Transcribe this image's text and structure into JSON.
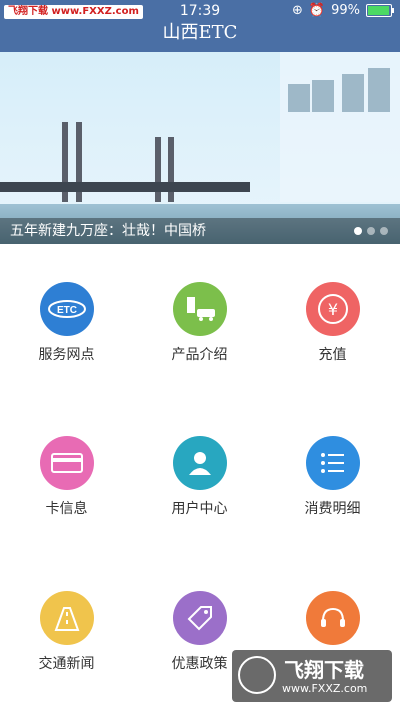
{
  "status_bar": {
    "watermark": "飞翔下载 www.FXXZ.com",
    "time": "17:39",
    "battery": "99%"
  },
  "header": {
    "title": "山西ETC"
  },
  "banner": {
    "caption": "五年新建九万座：壮哉！中国桥",
    "page_count": 3,
    "active_page": 1
  },
  "grid": [
    {
      "label": "服务网点",
      "icon": "etc-icon",
      "color": "#2e7fd4"
    },
    {
      "label": "产品介绍",
      "icon": "car-gas-icon",
      "color": "#7cbf4b"
    },
    {
      "label": "充值",
      "icon": "yuan-icon",
      "color": "#ef6464"
    },
    {
      "label": "卡信息",
      "icon": "card-icon",
      "color": "#e86bb4"
    },
    {
      "label": "用户中心",
      "icon": "user-icon",
      "color": "#28a7c0"
    },
    {
      "label": "消费明细",
      "icon": "list-icon",
      "color": "#2f8ee0"
    },
    {
      "label": "交通新闻",
      "icon": "road-icon",
      "color": "#f0c44c"
    },
    {
      "label": "优惠政策",
      "icon": "tag-icon",
      "color": "#9b6fc9"
    },
    {
      "label": "",
      "icon": "headset-icon",
      "color": "#f07a3a"
    }
  ],
  "bottom_watermark": {
    "text": "飞翔下载",
    "url": "www.FXXZ.com"
  }
}
